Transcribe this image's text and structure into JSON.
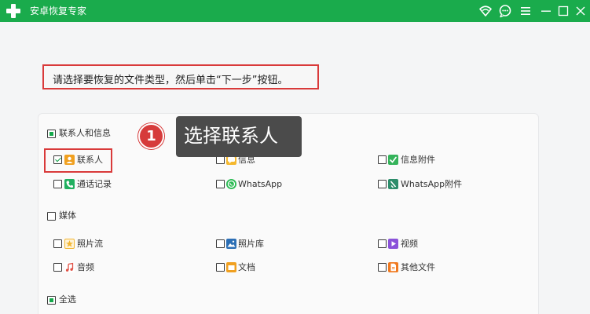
{
  "app": {
    "title": "安卓恢复专家"
  },
  "titlebar_icons": [
    "wifi-icon",
    "chat-icon",
    "menu-icon",
    "minimize-icon",
    "maximize-icon",
    "close-icon"
  ],
  "prompt": {
    "text": "请选择要恢复的文件类型，然后单击“下一步”按钮。"
  },
  "annotation": {
    "step_number": "1",
    "callout_text": "选择联系人"
  },
  "sections": {
    "contacts_info": {
      "label": "联系人和信息",
      "checked": true,
      "items": {
        "contacts": {
          "label": "联系人",
          "checked": true,
          "icon": "contacts-icon",
          "color": "#f0a020"
        },
        "messages": {
          "label": "信息",
          "checked": false,
          "icon": "messages-icon",
          "color": "#f5b82e"
        },
        "message_attachments": {
          "label": "信息附件",
          "checked": false,
          "icon": "message-attachments-icon",
          "color": "#34b35a"
        },
        "call_logs": {
          "label": "通话记录",
          "checked": false,
          "icon": "call-logs-icon",
          "color": "#21b060"
        },
        "whatsapp": {
          "label": "WhatsApp",
          "checked": false,
          "icon": "whatsapp-icon",
          "color": "#2dbb55"
        },
        "whatsapp_attachments": {
          "label": "WhatsApp附件",
          "checked": false,
          "icon": "whatsapp-attachments-icon",
          "color": "#2d8d6b"
        }
      }
    },
    "media": {
      "label": "媒体",
      "checked": false,
      "items": {
        "photo_stream": {
          "label": "照片流",
          "checked": false,
          "icon": "photo-stream-icon",
          "color": "#f3b632"
        },
        "photo_library": {
          "label": "照片库",
          "checked": false,
          "icon": "photo-library-icon",
          "color": "#2c6fb5"
        },
        "video": {
          "label": "视频",
          "checked": false,
          "icon": "video-icon",
          "color": "#8a52d9"
        },
        "audio": {
          "label": "音频",
          "checked": false,
          "icon": "audio-icon",
          "color": "#e05044"
        },
        "documents": {
          "label": "文档",
          "checked": false,
          "icon": "documents-icon",
          "color": "#f0a020"
        },
        "other_files": {
          "label": "其他文件",
          "checked": false,
          "icon": "other-files-icon",
          "color": "#f07a20"
        }
      }
    },
    "select_all": {
      "label": "全选",
      "checked": true
    }
  },
  "colors": {
    "brand": "#1aab4c",
    "highlight": "#d93a3a",
    "callout_bg": "#4b4b4b"
  }
}
